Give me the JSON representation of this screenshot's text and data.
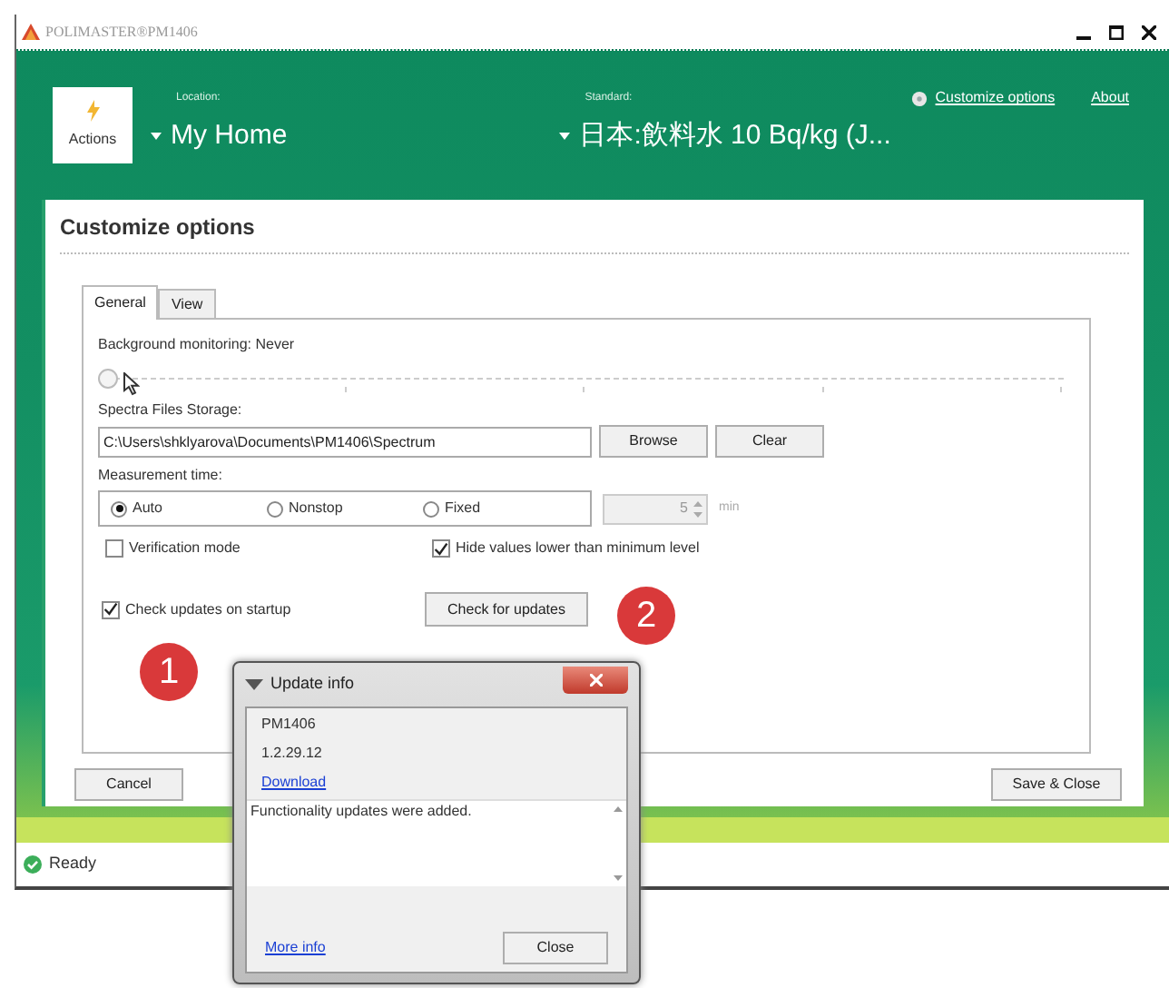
{
  "window": {
    "title": "POLIMASTER®PM1406"
  },
  "header": {
    "actions_label": "Actions",
    "location_label": "Location:",
    "location": "My Home",
    "standard_label": "Standard:",
    "standard": "日本:飲料水 10 Bq/kg (J...",
    "links": [
      "Customize options",
      "About"
    ]
  },
  "options": {
    "title": "Customize options",
    "tabs": [
      {
        "label": "General",
        "selected": true
      },
      {
        "label": "View",
        "selected": false
      }
    ],
    "background_monitoring": "Background monitoring: Never",
    "slider": {
      "level": 0
    },
    "storage_label": "Spectra Files Storage:",
    "storage_path": "C:\\Users\\shklyarova\\Documents\\PM1406\\Spectrum",
    "storage_buttons": [
      "Browse",
      "Clear"
    ],
    "measurement_label": "Measurement time:",
    "modes": [
      {
        "label": "Auto",
        "selected": true
      },
      {
        "label": "Nonstop",
        "selected": false
      },
      {
        "label": "Fixed",
        "selected": false
      }
    ],
    "fixed_field": {
      "value": "5",
      "unit": "min",
      "disabled": true
    },
    "checks": [
      {
        "label": "Verification mode",
        "checked": false
      },
      {
        "label": "Hide values lower than minimum level",
        "checked": true
      },
      {
        "label": "Check updates on startup",
        "checked": true
      }
    ],
    "check_button": "Check for updates",
    "buttons": [
      "Cancel",
      "Save & Close"
    ]
  },
  "status": "Ready",
  "callouts": [
    "1",
    "2"
  ],
  "dialog": {
    "title": "Update info",
    "product": "PM1406",
    "version": "1.2.29.12",
    "download": "Download",
    "notes": "Functionality updates were added.",
    "more_info": "More info",
    "close": "Close"
  }
}
